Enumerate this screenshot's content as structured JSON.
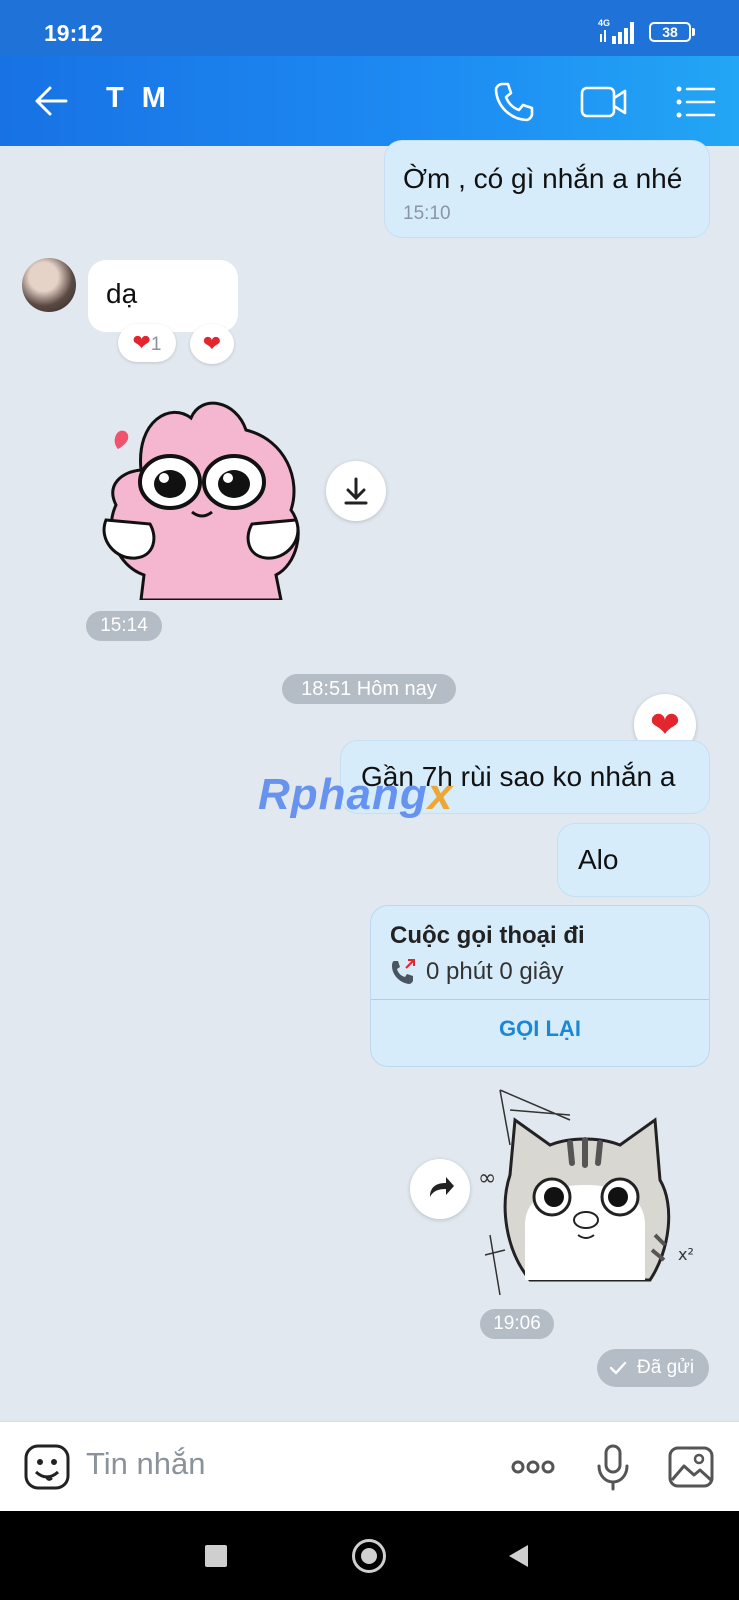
{
  "status_bar": {
    "time": "19:12",
    "network": "4G",
    "battery": "38"
  },
  "header": {
    "title": "T M"
  },
  "messages": {
    "m1": {
      "text": "Ờm , có gì nhắn a nhé",
      "time": "15:10"
    },
    "m2": {
      "text": "dạ",
      "reaction_count": "1"
    },
    "sticker1": {
      "time": "15:14"
    },
    "date_divider": "18:51 Hôm nay",
    "m3": {
      "text": "Gần 7h rùi sao ko nhắn a"
    },
    "m4": {
      "text": "Alo"
    },
    "call": {
      "title": "Cuộc gọi thoại đi",
      "duration": "0 phút 0 giây",
      "action": "GỌI LẠI"
    },
    "sticker2": {
      "time": "19:06"
    },
    "sent_status": "Đã gửi"
  },
  "watermark": {
    "main": "Rphang",
    "accent": "x"
  },
  "composer": {
    "placeholder": "Tin nhắn"
  },
  "colors": {
    "header": "#1d8cf3",
    "outgoing_bubble": "#d6ecfb",
    "background": "#e2e8ef",
    "accent": "#1b87d6"
  }
}
